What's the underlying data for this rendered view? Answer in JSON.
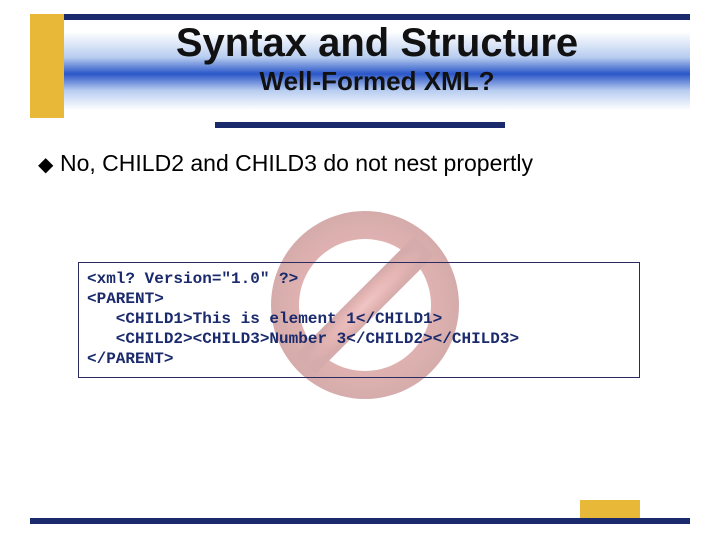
{
  "title": {
    "main": "Syntax and Structure",
    "sub": "Well-Formed XML?"
  },
  "bullet": {
    "symbol": "◆",
    "text": "No, CHILD2 and CHILD3 do not nest propertly"
  },
  "code": {
    "lines": [
      "<xml? Version=\"1.0\" ?>",
      "<PARENT>",
      "   <CHILD1>This is element 1</CHILD1>",
      "   <CHILD2><CHILD3>Number 3</CHILD2></CHILD3>",
      "</PARENT>"
    ]
  },
  "colors": {
    "accent_navy": "#1a2a6c",
    "accent_gold": "#e8b838",
    "prohibit_red": "#c0504d"
  }
}
